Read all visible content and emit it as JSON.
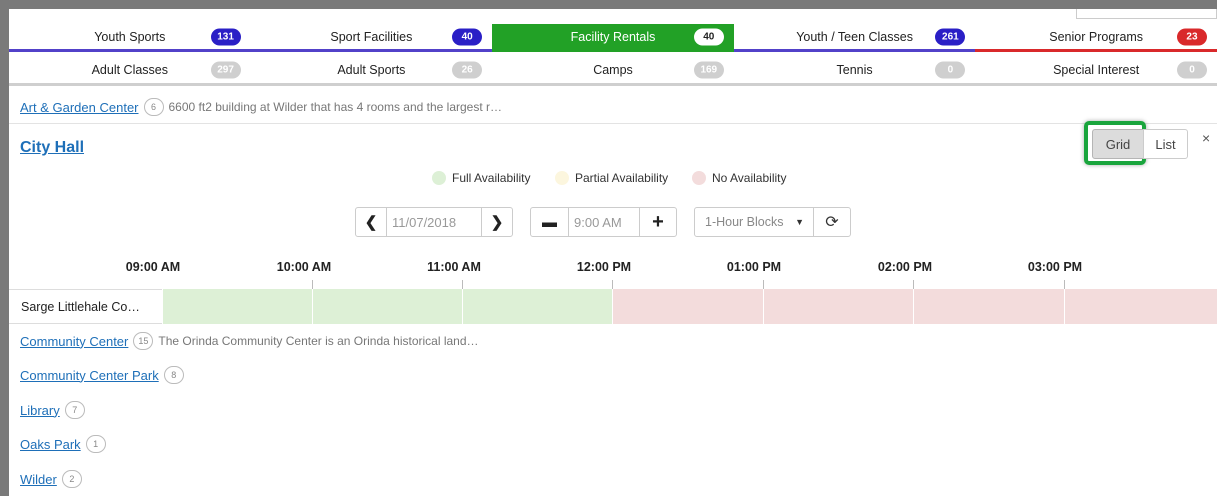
{
  "colors": {
    "full": "#ddf0d6",
    "partial": "#fcf6de",
    "none": "#f3dcdc",
    "active_tab": "#22a126",
    "count_blue": "#2a1fc6",
    "count_red": "#d9292b",
    "count_gray": "#cfcfcf",
    "link": "#1e6fb8"
  },
  "tabs_row1": [
    {
      "label": "Youth Sports",
      "count": "131"
    },
    {
      "label": "Sport Facilities",
      "count": "40"
    },
    {
      "label": "Facility Rentals",
      "count": "40"
    },
    {
      "label": "Youth / Teen Classes",
      "count": "261"
    },
    {
      "label": "Senior Programs",
      "count": "23"
    }
  ],
  "tabs_row2": [
    {
      "label": "Adult Classes",
      "count": "297"
    },
    {
      "label": "Adult Sports",
      "count": "26"
    },
    {
      "label": "Camps",
      "count": "169"
    },
    {
      "label": "Tennis",
      "count": "0"
    },
    {
      "label": "Special Interest",
      "count": "0"
    }
  ],
  "facilities": {
    "art": {
      "name": "Art & Garden Center",
      "count": "6",
      "desc": "6600 ft2 building at Wilder that has 4 rooms and the largest r…"
    },
    "community_center": {
      "name": "Community Center",
      "count": "15",
      "desc": "The Orinda Community Center is an Orinda historical land…"
    },
    "community_park": {
      "name": "Community Center Park",
      "count": "8"
    },
    "library": {
      "name": "Library",
      "count": "7"
    },
    "oaks": {
      "name": "Oaks Park",
      "count": "1"
    },
    "wilder": {
      "name": "Wilder",
      "count": "2"
    }
  },
  "panel": {
    "title": "City Hall",
    "close": "×",
    "view_grid": "Grid",
    "view_list": "List"
  },
  "legend": {
    "full": "Full Availability",
    "partial": "Partial Availability",
    "none": "No Availability"
  },
  "controls": {
    "date_value": "11/07/2018",
    "time_value": "9:00 AM",
    "block_value": "1-Hour Blocks"
  },
  "timeline": {
    "labels": [
      "09:00 AM",
      "10:00 AM",
      "11:00 AM",
      "12:00 PM",
      "01:00 PM",
      "02:00 PM",
      "03:00 PM"
    ],
    "room": "Sarge Littlehale Co…",
    "slots": [
      "full",
      "full",
      "full",
      "none",
      "none",
      "none",
      "none"
    ]
  }
}
